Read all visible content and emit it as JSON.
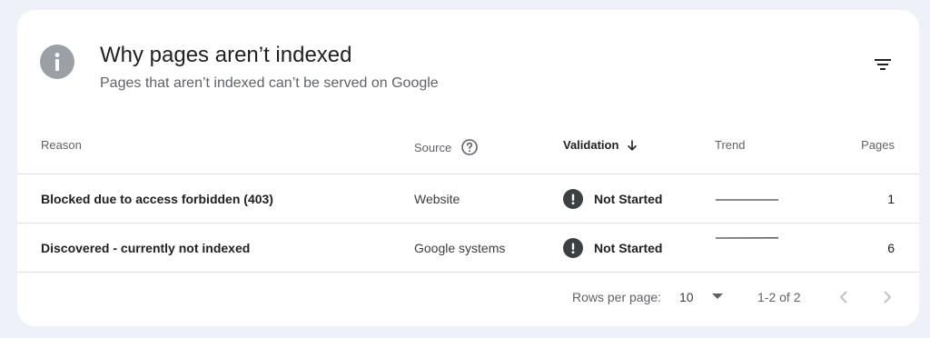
{
  "header": {
    "title": "Why pages aren’t indexed",
    "subtitle": "Pages that aren’t indexed can’t be served on Google",
    "icon": "info-icon",
    "filter_icon": "filter-icon"
  },
  "table": {
    "columns": {
      "reason": "Reason",
      "source": "Source",
      "validation": "Validation",
      "trend": "Trend",
      "pages": "Pages"
    },
    "rows": [
      {
        "reason": "Blocked due to access forbidden (403)",
        "source": "Website",
        "validation": "Not Started",
        "pages": "1",
        "trend": [
          1,
          1
        ]
      },
      {
        "reason": "Discovered - currently not indexed",
        "source": "Google systems",
        "validation": "Not Started",
        "pages": "6",
        "trend": [
          5,
          6
        ]
      }
    ]
  },
  "pagination": {
    "rows_per_page_label": "Rows per page:",
    "rows_per_page_value": "10",
    "range": "1-2 of 2"
  },
  "colors": {
    "background": "#eef2f8",
    "card": "#ffffff",
    "status_icon": "#3c4043",
    "info_icon": "#9aa0a6"
  }
}
